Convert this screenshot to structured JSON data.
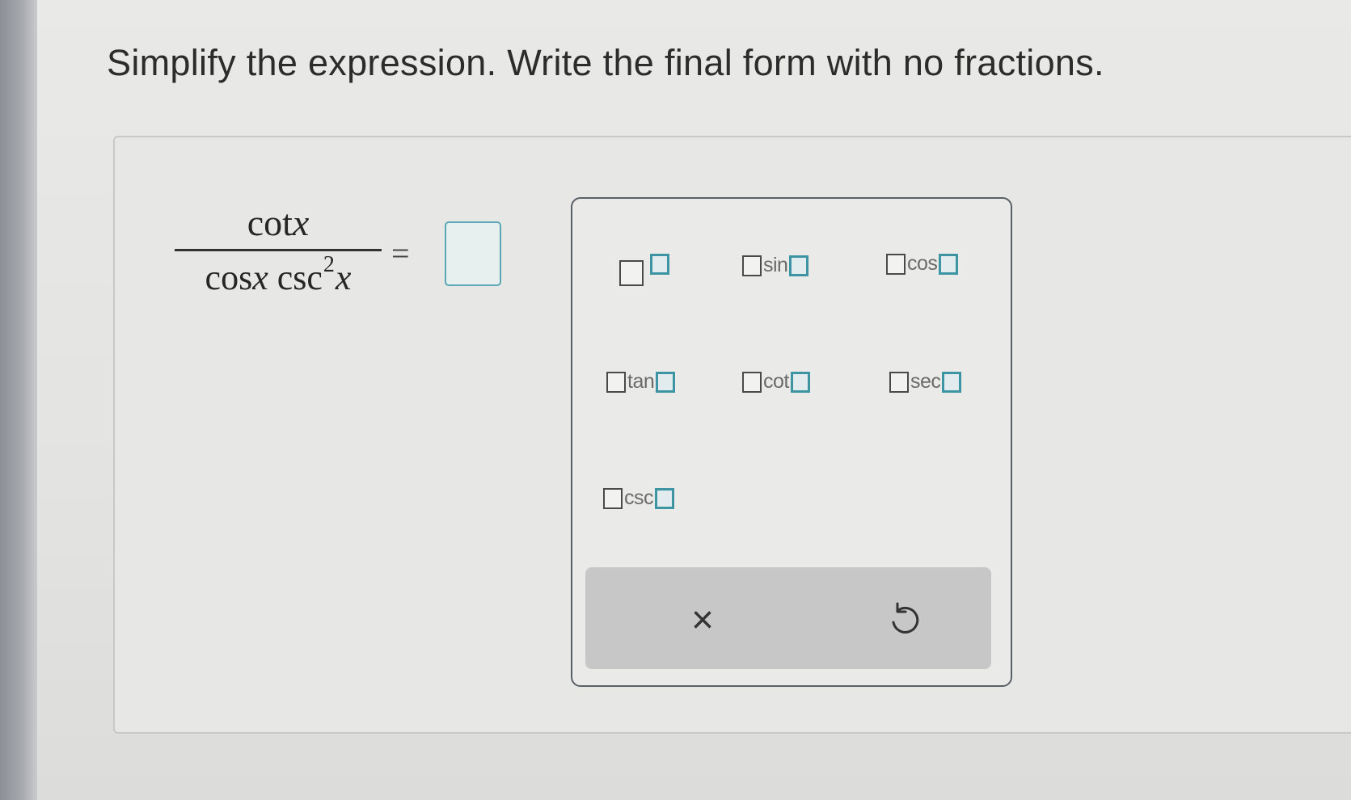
{
  "instruction": "Simplify the expression. Write the final form with no fractions.",
  "expression": {
    "numerator": "cot",
    "numerator_var": "x",
    "denominator_fn1": "cos",
    "denominator_var1": "x",
    "denominator_fn2": "csc",
    "denominator_exp": "2",
    "denominator_var2": "x",
    "equals": "="
  },
  "palette": {
    "keys": [
      {
        "id": "power",
        "label": ""
      },
      {
        "id": "sin",
        "label": "sin"
      },
      {
        "id": "cos",
        "label": "cos"
      },
      {
        "id": "tan",
        "label": "tan"
      },
      {
        "id": "cot",
        "label": "cot"
      },
      {
        "id": "sec",
        "label": "sec"
      },
      {
        "id": "csc",
        "label": "csc"
      }
    ],
    "clear_symbol": "×",
    "undo_icon": "undo-icon"
  },
  "colors": {
    "accent": "#3d95a4",
    "panel_border": "#5b5f66",
    "action_bar": "#c6c7c6"
  }
}
